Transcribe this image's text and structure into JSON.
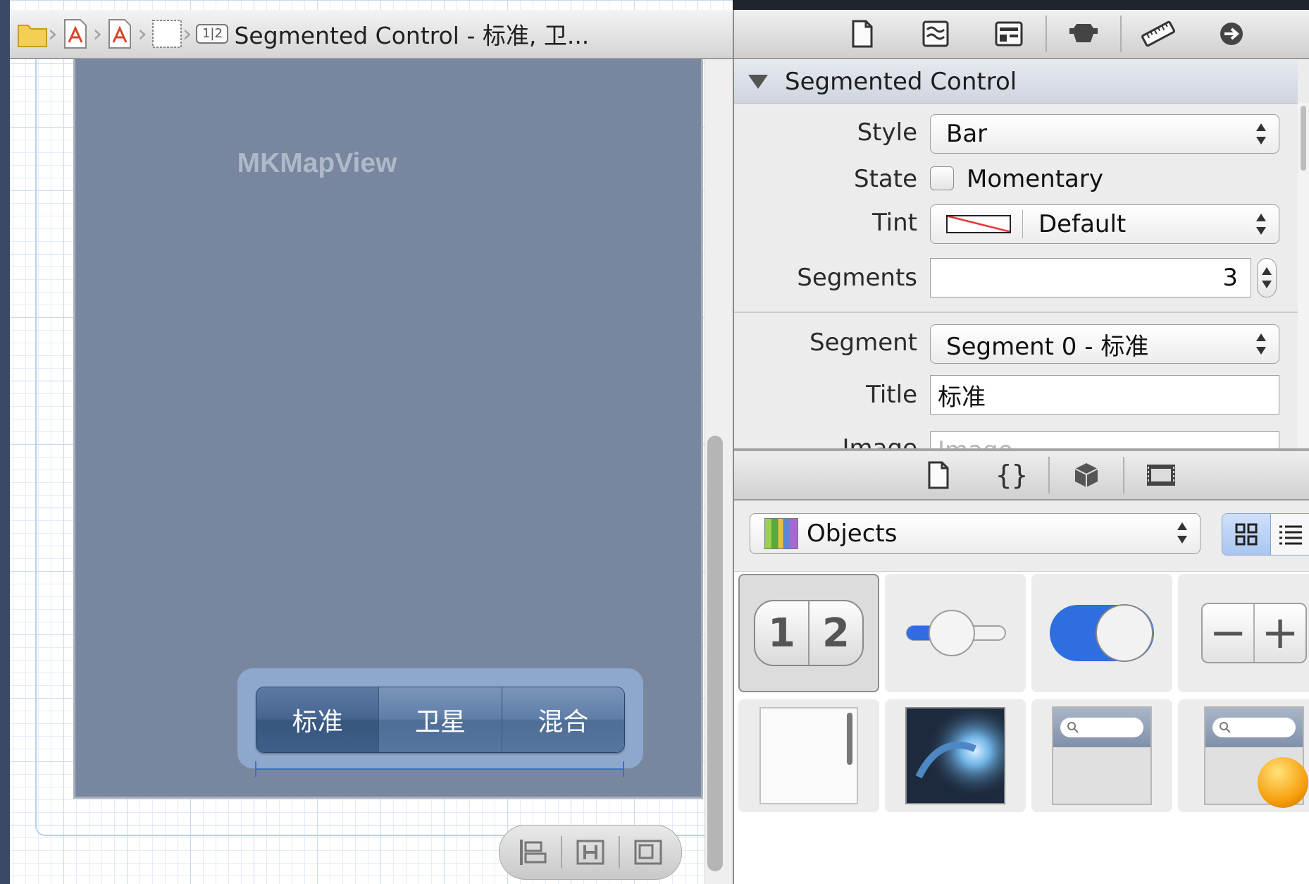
{
  "jumpbar": {
    "crumb_icons": [
      "folder-icon",
      "xib-file-icon",
      "xib-file-icon",
      "view-icon",
      "segmented-control-icon"
    ],
    "current_label": "Segmented Control - 标准, 卫..."
  },
  "canvas": {
    "map_view_label": "MKMapView",
    "segments": [
      "标准",
      "卫星",
      "混合"
    ],
    "selected_segment": 0
  },
  "inspector": {
    "toolbar_icons": [
      "file-inspector-icon",
      "quick-help-icon",
      "identity-inspector-icon",
      "attributes-inspector-icon",
      "size-inspector-icon",
      "connections-inspector-icon"
    ],
    "section_title": "Segmented Control",
    "style_label": "Style",
    "style_value": "Bar",
    "state_label": "State",
    "state_checkbox_label": "Momentary",
    "state_checked": false,
    "tint_label": "Tint",
    "tint_value": "Default",
    "segments_label": "Segments",
    "segments_value": "3",
    "segment_label": "Segment",
    "segment_value": "Segment 0 - 标准",
    "title_label": "Title",
    "title_value": "标准",
    "image_label": "Image",
    "image_placeholder": "Image"
  },
  "library": {
    "toolbar_icons": [
      "file-template-icon",
      "code-snippet-icon",
      "object-library-icon",
      "media-library-icon"
    ],
    "filter_value": "Objects",
    "items": [
      {
        "name": "segmented-control-item",
        "text": "1 2"
      },
      {
        "name": "slider-item"
      },
      {
        "name": "switch-item"
      },
      {
        "name": "stepper-item",
        "text_minus": "−",
        "text_plus": "+"
      },
      {
        "name": "table-view-item"
      },
      {
        "name": "image-view-item"
      },
      {
        "name": "search-bar-item"
      },
      {
        "name": "search-bar-display-controller-item"
      }
    ]
  },
  "colors": {
    "map_view_bg": "#78879f",
    "segment_bar": "#4e6d97",
    "accent_blue": "#2f6ee0"
  }
}
